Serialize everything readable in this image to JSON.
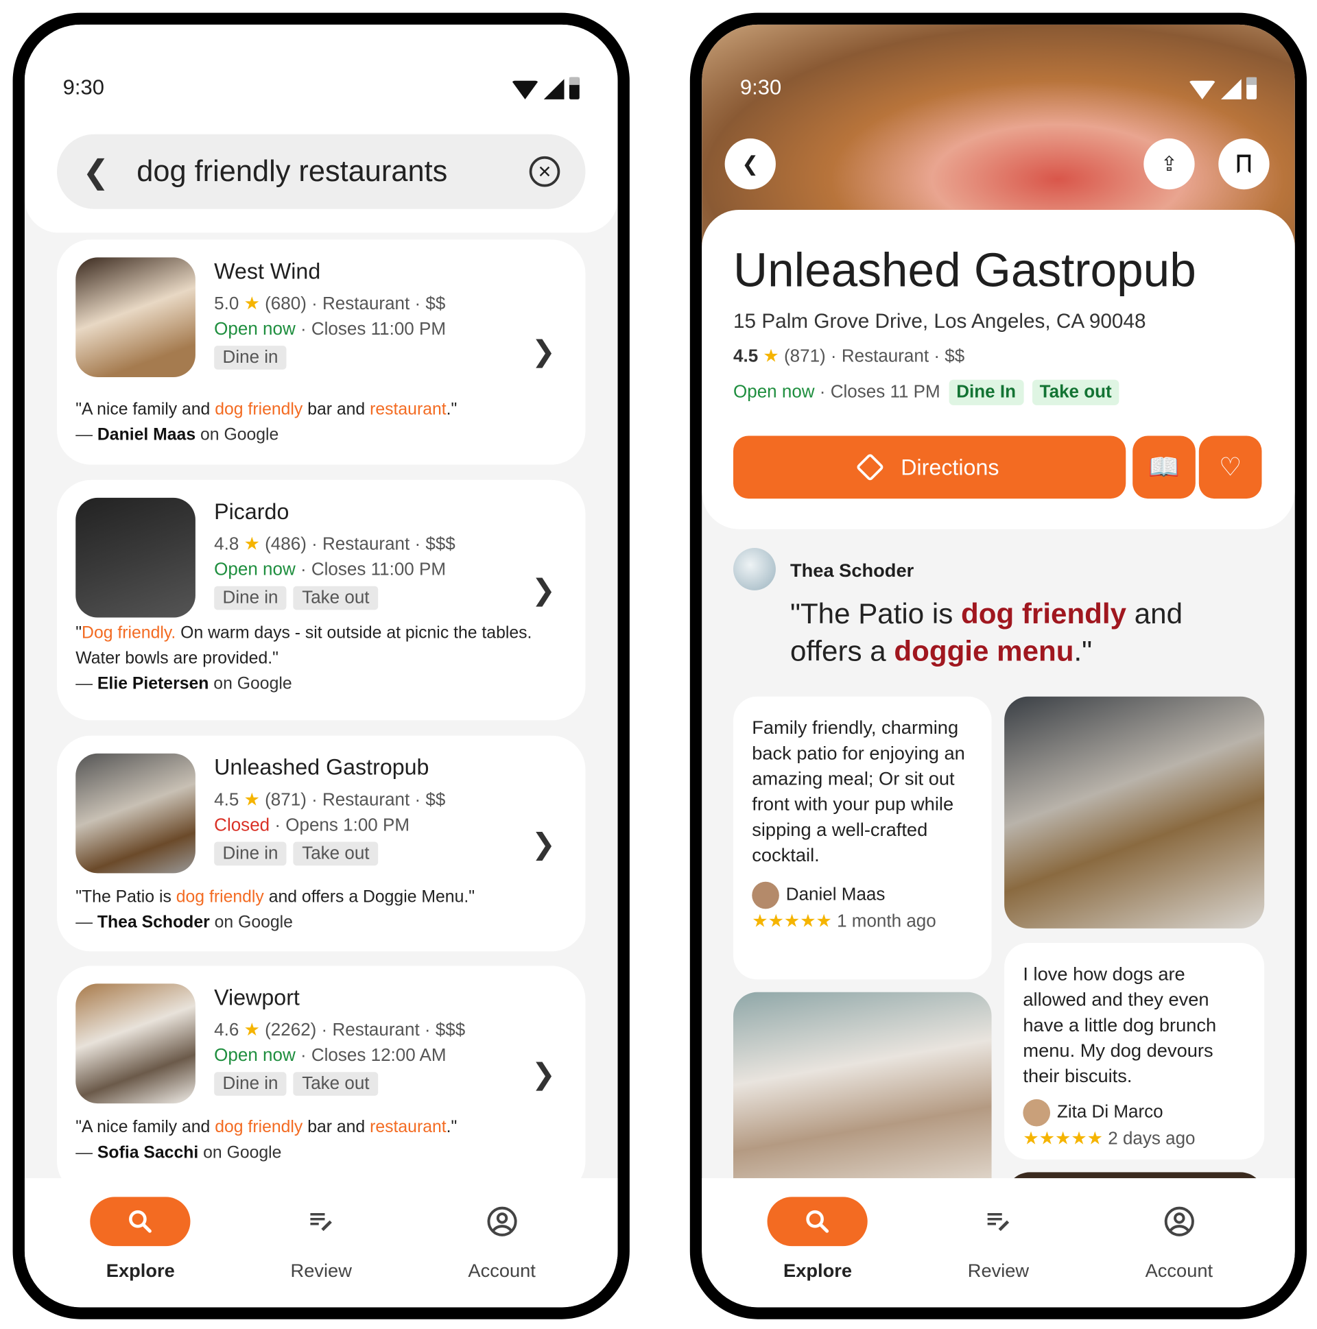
{
  "status": {
    "time": "9:30"
  },
  "list_screen": {
    "search": {
      "query": "dog friendly restaurants"
    },
    "results": [
      {
        "name": "West Wind",
        "rating": "5.0",
        "reviews": "(680)",
        "category": "Restaurant",
        "price": "$$",
        "status": "Open now",
        "status_type": "open",
        "hours": "Closes 11:00 PM",
        "tags": [
          "Dine in"
        ],
        "quote_parts": [
          {
            "t": "\"A nice family and ",
            "h": false
          },
          {
            "t": "dog friendly",
            "h": true
          },
          {
            "t": " bar and ",
            "h": false
          },
          {
            "t": "restaurant",
            "h": true
          },
          {
            "t": ".\"",
            "h": false
          }
        ],
        "author": "Daniel Maas",
        "source": "on Google"
      },
      {
        "name": "Picardo",
        "rating": "4.8",
        "reviews": "(486)",
        "category": "Restaurant",
        "price": "$$$",
        "status": "Open now",
        "status_type": "open",
        "hours": "Closes 11:00 PM",
        "tags": [
          "Dine in",
          "Take out"
        ],
        "quote_parts": [
          {
            "t": "\"",
            "h": false
          },
          {
            "t": "Dog friendly.",
            "h": true
          },
          {
            "t": " On warm days - sit outside at picnic the tables. Water bowls are provided.\"",
            "h": false
          }
        ],
        "author": "Elie Pietersen",
        "source": "on Google"
      },
      {
        "name": "Unleashed Gastropub",
        "rating": "4.5",
        "reviews": "(871)",
        "category": "Restaurant",
        "price": "$$",
        "status": "Closed",
        "status_type": "closed",
        "hours": "Opens 1:00 PM",
        "tags": [
          "Dine in",
          "Take out"
        ],
        "quote_parts": [
          {
            "t": "\"The Patio is ",
            "h": false
          },
          {
            "t": "dog friendly",
            "h": true
          },
          {
            "t": " and offers a Doggie Menu.\"",
            "h": false
          }
        ],
        "author": "Thea Schoder",
        "source": "on Google"
      },
      {
        "name": "Viewport",
        "rating": "4.6",
        "reviews": "(2262)",
        "category": "Restaurant",
        "price": "$$$",
        "status": "Open now",
        "status_type": "open",
        "hours": "Closes 12:00 AM",
        "tags": [
          "Dine in",
          "Take out"
        ],
        "quote_parts": [
          {
            "t": "\"A nice family and ",
            "h": false
          },
          {
            "t": "dog friendly",
            "h": true
          },
          {
            "t": " bar and ",
            "h": false
          },
          {
            "t": "restaurant",
            "h": true
          },
          {
            "t": ".\"",
            "h": false
          }
        ],
        "author": "Sofia Sacchi",
        "source": "on Google"
      }
    ]
  },
  "detail_screen": {
    "title": "Unleashed Gastropub",
    "address": "15 Palm Grove Drive, Los Angeles, CA 90048",
    "rating": "4.5",
    "reviews": "(871)",
    "category": "Restaurant",
    "price": "$$",
    "status": "Open now",
    "hours": "Closes 11 PM",
    "tags": [
      "Dine In",
      "Take out"
    ],
    "directions_label": "Directions",
    "featured_review": {
      "author": "Thea Schoder",
      "quote_parts": [
        {
          "t": "\"The Patio is ",
          "h": false
        },
        {
          "t": "dog friendly",
          "h": true
        },
        {
          "t": " and offers a ",
          "h": false
        },
        {
          "t": "doggie menu",
          "h": true
        },
        {
          "t": ".\"",
          "h": false
        }
      ]
    },
    "reviews_list": [
      {
        "text": "Family friendly, charming back patio for enjoying an amazing meal; Or sit out front with your pup while sipping a well-crafted cocktail.",
        "author": "Daniel Maas",
        "stars": "★★★★★",
        "time": "1 month ago"
      },
      {
        "text": "I love how dogs are allowed and they even have a little dog brunch menu. My dog devours their biscuits.",
        "author": "Zita Di Marco",
        "stars": "★★★★★",
        "time": "2 days ago"
      }
    ]
  },
  "nav": [
    {
      "label": "Explore",
      "icon": "search-icon",
      "active": true
    },
    {
      "label": "Review",
      "icon": "review-edit-icon",
      "active": false
    },
    {
      "label": "Account",
      "icon": "account-icon",
      "active": false
    }
  ],
  "colors": {
    "accent": "#f36b22",
    "open": "#1e8e3e",
    "closed": "#d93025",
    "highlight_dark": "#a0171f",
    "star": "#f5b400"
  }
}
